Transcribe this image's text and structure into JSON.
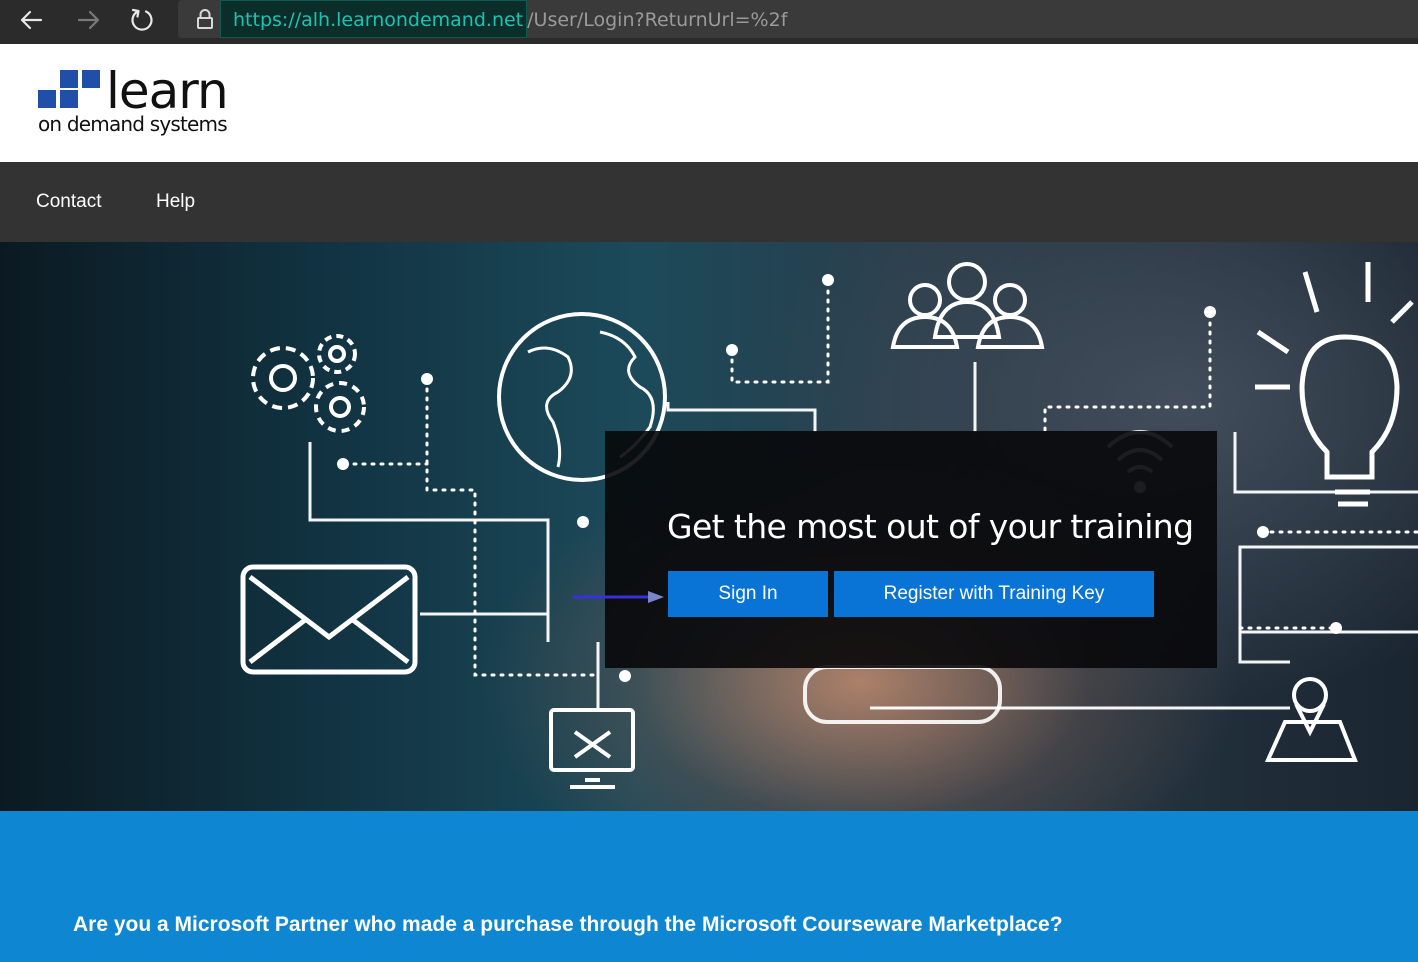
{
  "browser": {
    "url_host": "https://alh.learnondemand.net",
    "url_path": "/User/Login?ReturnUrl=%2f"
  },
  "logo": {
    "word": "learn",
    "subtitle": "on demand systems"
  },
  "nav": {
    "items": [
      {
        "label": "Contact"
      },
      {
        "label": "Help"
      }
    ]
  },
  "hero": {
    "title": "Get the most out of your training",
    "signin_label": "Sign In",
    "register_label": "Register with Training Key"
  },
  "partner": {
    "question": "Are you a Microsoft Partner who made a purchase through the Microsoft Courseware Marketplace?"
  },
  "colors": {
    "accent_button": "#0a74d6",
    "band_blue": "#0f86d2",
    "nav_bg": "#333333",
    "annotation_arrow": "#3a2fe0"
  }
}
